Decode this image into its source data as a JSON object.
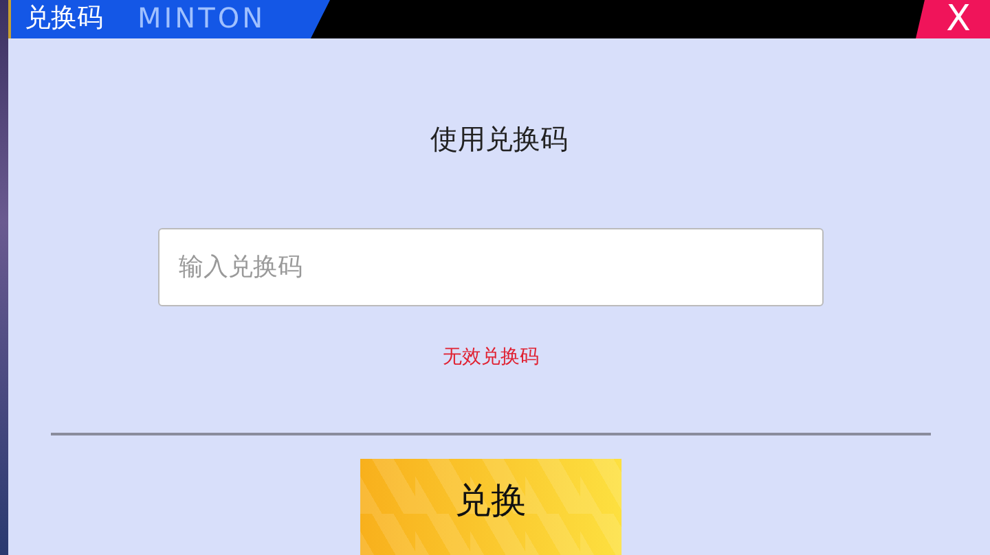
{
  "dialog": {
    "title": "兑换码",
    "title_backdrop": "MINTON",
    "close": "X"
  },
  "heading": "使用兑换码",
  "code_field": {
    "placeholder": "输入兑换码"
  },
  "error": "无效兑换码",
  "redeem_button": "兑换"
}
